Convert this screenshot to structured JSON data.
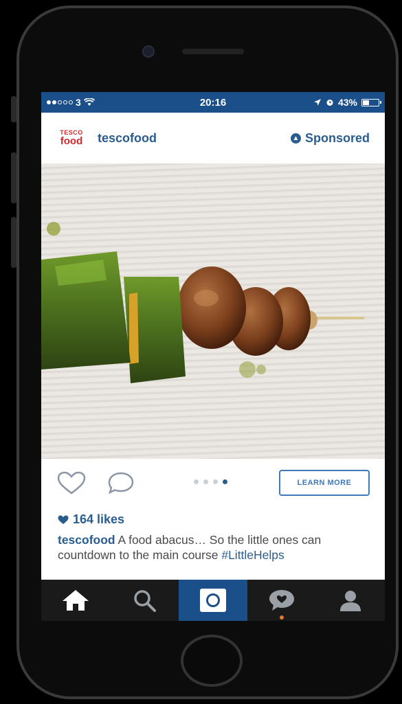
{
  "status_bar": {
    "carrier": "3",
    "time": "20:16",
    "battery": "43%",
    "battery_level": 0.43
  },
  "post": {
    "logo": {
      "line1": "TESCO",
      "line2": "food"
    },
    "username": "tescofood",
    "sponsored_label": "Sponsored",
    "learn_more_label": "LEARN MORE",
    "likes": "164 likes",
    "caption_user": "tescofood",
    "caption_text": " A food abacus… So the little ones can countdown to the main course ",
    "hashtag": "#LittleHelps",
    "carousel_total": 4,
    "carousel_index": 4
  },
  "tabs": [
    {
      "id": "home",
      "icon": "home-icon"
    },
    {
      "id": "search",
      "icon": "search-icon"
    },
    {
      "id": "camera",
      "icon": "camera-icon",
      "active": true
    },
    {
      "id": "activity",
      "icon": "activity-icon"
    },
    {
      "id": "profile",
      "icon": "profile-icon"
    }
  ],
  "colors": {
    "brand_blue": "#2a5d8f",
    "status_bar": "#1a4f8a",
    "tesco_red": "#d12a2f",
    "notification": "#e3782a"
  }
}
